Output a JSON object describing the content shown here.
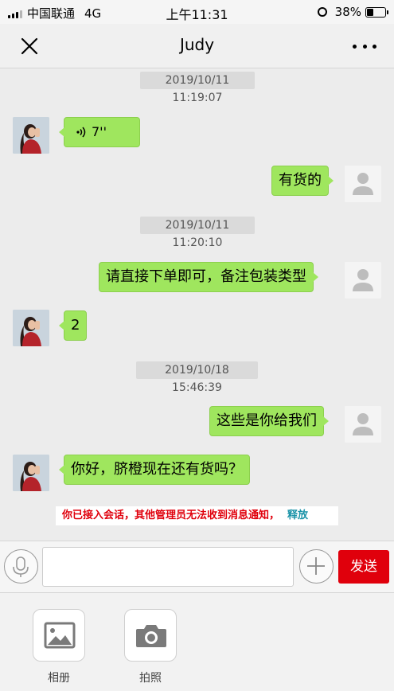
{
  "status_bar": {
    "carrier": "中国联通",
    "network": "4G",
    "time": "上午11:31",
    "battery": "38%",
    "battery_level": 0.38
  },
  "nav": {
    "title": "Judy",
    "close_icon": "close-icon",
    "more_icon": "more-dots-icon"
  },
  "messages": {
    "ts1": "2019/10/11 11:19:07",
    "voice_duration": "7''",
    "m_out1": "有货的",
    "ts2": "2019/10/11 11:20:10",
    "m_out2": "请直接下单即可，备注包装类型",
    "m_in2": "2",
    "ts3": "2019/10/18 15:46:39",
    "m_out3": "这些是你给我们",
    "m_in3": "你好，脐橙现在还有货吗？"
  },
  "notice": {
    "text": "你已接入会话，其他管理员无法收到消息通知，",
    "action": "释放"
  },
  "input_bar": {
    "value": "",
    "placeholder": "",
    "send_label": "发送",
    "mic_icon": "microphone-icon",
    "plus_icon": "plus-icon"
  },
  "panel": {
    "album_label": "相册",
    "camera_label": "拍照"
  },
  "colors": {
    "bubble": "#9fe65e",
    "accent_red": "#e0000c",
    "link": "#1a93a8"
  }
}
